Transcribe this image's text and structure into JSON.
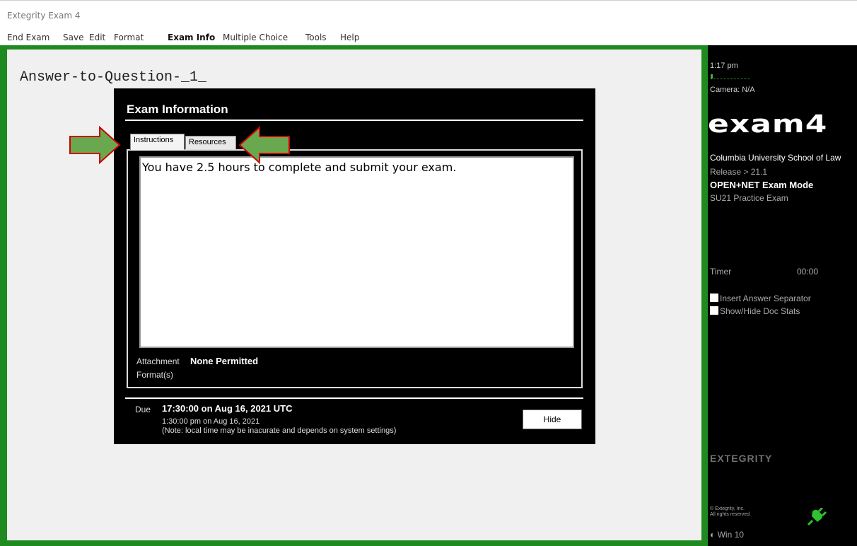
{
  "window": {
    "title": "Extegrity Exam 4"
  },
  "menu": {
    "items": [
      {
        "label": "End Exam"
      },
      {
        "label": "Save"
      },
      {
        "label": "Edit"
      },
      {
        "label": "Format"
      },
      {
        "label": "Exam Info",
        "active": true
      },
      {
        "label": "Multiple Choice"
      },
      {
        "label": "Tools"
      },
      {
        "label": "Help"
      }
    ]
  },
  "document": {
    "title": "Answer-to-Question-_1_"
  },
  "dialog": {
    "heading": "Exam Information",
    "tabs": [
      {
        "label": "Instructions",
        "selected": true
      },
      {
        "label": "Resources",
        "selected": false
      }
    ],
    "instructions_text": "You have 2.5 hours to complete and submit your exam.",
    "attachment_label": "Attachment",
    "attachment_value": "None Permitted",
    "formats_label": "Format(s)",
    "due_label": "Due",
    "due_utc": "17:30:00 on Aug 16, 2021 UTC",
    "due_local": "1:30:00 pm on Aug 16, 2021",
    "due_note": "(Note: local time may be inacurate and depends on system settings)",
    "hide_label": "Hide"
  },
  "sidebar": {
    "time": "1:17 pm",
    "camera": "Camera: N/A",
    "logo": "exam4",
    "school": "Columbia University School of Law",
    "release": "Release > 21.1",
    "mode": "OPEN+NET Exam Mode",
    "exam_name": "SU21 Practice Exam",
    "timer_label": "Timer",
    "timer_value": "00:00",
    "options": [
      {
        "label": "Insert Answer Separator",
        "checked": false
      },
      {
        "label": "Show/Hide Doc Stats",
        "checked": false
      }
    ],
    "brand": "EXTEGRITY",
    "copyright_line1": "© Extegrity, Inc.",
    "copyright_line2": "All rights reserved.",
    "os": "Win 10"
  },
  "colors": {
    "frame_green": "#1f8a1f",
    "arrow_fill": "#6aa84f",
    "arrow_outline": "#cc0000"
  }
}
